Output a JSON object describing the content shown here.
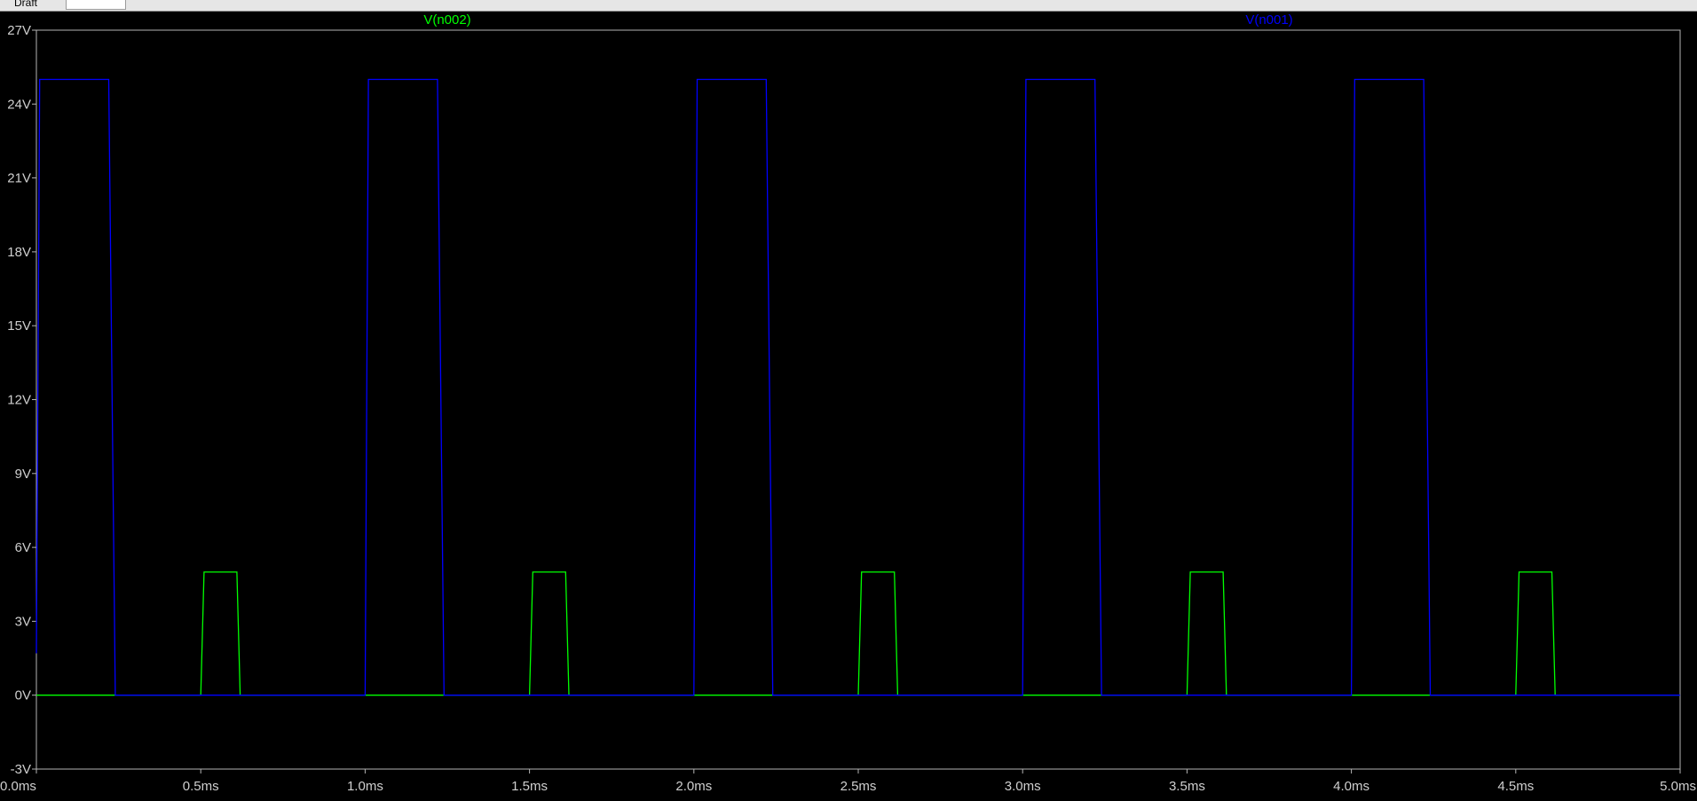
{
  "window": {
    "title": "Draft"
  },
  "colors": {
    "background": "#000000",
    "frame": "#b4b4b4",
    "tick_text": "#cfcfcf"
  },
  "chart_data": {
    "type": "line",
    "title": "",
    "xlabel": "",
    "ylabel": "",
    "xlim": [
      0,
      5.0
    ],
    "ylim": [
      -3,
      27
    ],
    "x_unit": "ms",
    "y_unit": "V",
    "grid": false,
    "x_ticks": [
      "0.0ms",
      "0.5ms",
      "1.0ms",
      "1.5ms",
      "2.0ms",
      "2.5ms",
      "3.0ms",
      "3.5ms",
      "4.0ms",
      "4.5ms",
      "5.0ms"
    ],
    "y_ticks": [
      "-3V",
      "0V",
      "3V",
      "6V",
      "9V",
      "12V",
      "15V",
      "18V",
      "21V",
      "24V",
      "27V"
    ],
    "series": [
      {
        "name": "V(n002)",
        "color": "#00ff00",
        "label_x": 1.25,
        "points": [
          [
            0.0,
            0
          ],
          [
            0.5,
            0
          ],
          [
            0.51,
            5
          ],
          [
            0.61,
            5
          ],
          [
            0.62,
            0
          ],
          [
            1.5,
            0
          ],
          [
            1.51,
            5
          ],
          [
            1.61,
            5
          ],
          [
            1.62,
            0
          ],
          [
            2.5,
            0
          ],
          [
            2.51,
            5
          ],
          [
            2.61,
            5
          ],
          [
            2.62,
            0
          ],
          [
            3.5,
            0
          ],
          [
            3.51,
            5
          ],
          [
            3.61,
            5
          ],
          [
            3.62,
            0
          ],
          [
            4.5,
            0
          ],
          [
            4.51,
            5
          ],
          [
            4.61,
            5
          ],
          [
            4.62,
            0
          ],
          [
            5.0,
            0
          ]
        ]
      },
      {
        "name": "V(n001)",
        "color": "#0000ff",
        "label_x": 3.75,
        "points": [
          [
            0.0,
            1.7
          ],
          [
            0.01,
            25
          ],
          [
            0.22,
            25
          ],
          [
            0.24,
            0
          ],
          [
            1.0,
            0
          ],
          [
            1.01,
            25
          ],
          [
            1.22,
            25
          ],
          [
            1.24,
            0
          ],
          [
            2.0,
            0
          ],
          [
            2.01,
            25
          ],
          [
            2.22,
            25
          ],
          [
            2.24,
            0
          ],
          [
            3.0,
            0
          ],
          [
            3.01,
            25
          ],
          [
            3.22,
            25
          ],
          [
            3.24,
            0
          ],
          [
            4.0,
            0
          ],
          [
            4.01,
            25
          ],
          [
            4.22,
            25
          ],
          [
            4.24,
            0
          ],
          [
            5.0,
            0
          ]
        ]
      }
    ]
  }
}
